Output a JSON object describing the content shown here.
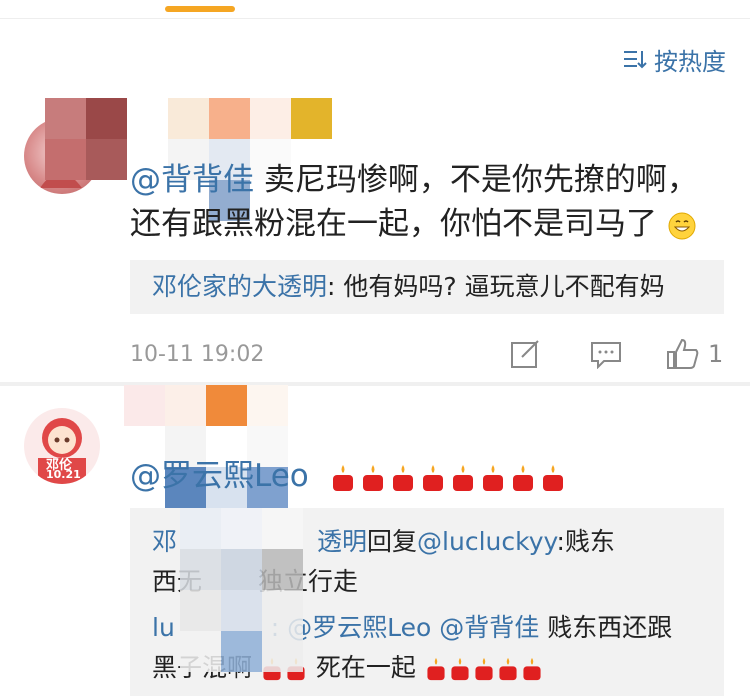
{
  "sort": {
    "label": "按热度"
  },
  "comment1": {
    "mention": "@背背佳",
    "text": " 卖尼玛惨啊，不是你先撩的啊，还有跟黑粉混在一起，你怕不是司马了",
    "reply": {
      "user": "邓伦家的大透明",
      "text": ": 他有妈吗? 逼玩意儿不配有妈"
    },
    "time": "10-11 19:02",
    "like_count": "1"
  },
  "comment2": {
    "username": "@罗云熙Leo",
    "candle_count": 8,
    "avatar_text": "邓伦",
    "avatar_sub": "10.21",
    "replies": {
      "line1_user": "邓",
      "line1_user2": "透明",
      "line1_reply": "回复",
      "line1_mention": "@lucluckyy",
      "line1_text": ":贱东",
      "line2_text_a": "西无",
      "line2_text_b": "独立行走",
      "line3_user": "lu",
      "line3_mentions": ": @罗云熙Leo @背背佳",
      "line3_text": " 贱东西还跟",
      "line4_text": "黑子混啊",
      "line4_text2": "死在一起"
    }
  },
  "colors": {
    "link": "#3b73a8",
    "accent": "#f5a623",
    "gray_bg": "#f2f2f2"
  }
}
